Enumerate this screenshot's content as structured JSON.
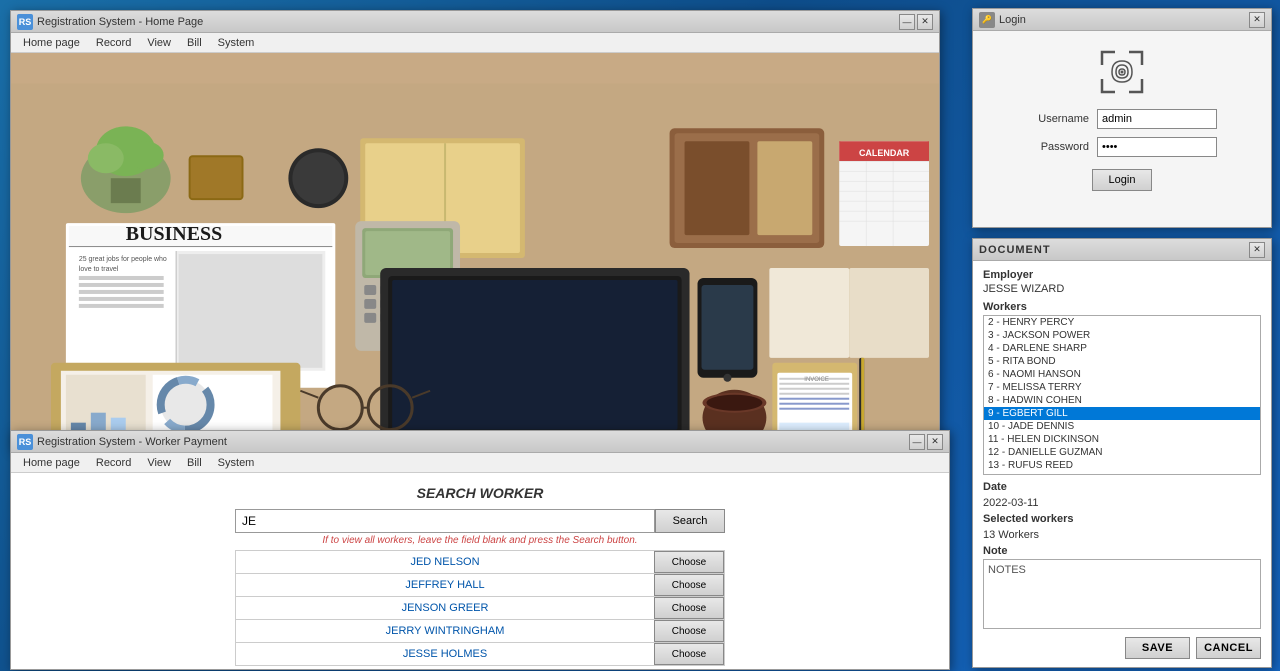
{
  "desktop": {
    "background_color": "#1a6fa8"
  },
  "home_window": {
    "title": "Registration System - Home Page",
    "icon": "RS",
    "controls": {
      "minimize": "—",
      "close": "✕"
    },
    "menu": {
      "items": [
        "Home page",
        "Record",
        "View",
        "Bill",
        "System"
      ]
    }
  },
  "payment_window": {
    "title": "Registration System - Worker Payment",
    "icon": "RS",
    "controls": {
      "minimize": "—",
      "close": "✕"
    },
    "menu": {
      "items": [
        "Home page",
        "Record",
        "View",
        "Bill",
        "System"
      ]
    },
    "content": {
      "title": "SEARCH WORKER",
      "search_value": "JE",
      "search_button": "Search",
      "hint": "If to view all workers, leave the field blank and press the Search button.",
      "workers": [
        {
          "name": "JED NELSON",
          "choose": "Choose"
        },
        {
          "name": "JEFFREY HALL",
          "choose": "Choose"
        },
        {
          "name": "JENSON GREER",
          "choose": "Choose"
        },
        {
          "name": "JERRY WINTRINGHAM",
          "choose": "Choose"
        },
        {
          "name": "JESSE HOLMES",
          "choose": "Choose"
        }
      ]
    }
  },
  "login_window": {
    "title": "Login",
    "username_label": "Username",
    "username_value": "admin",
    "password_label": "Password",
    "password_value": "••••",
    "login_button": "Login"
  },
  "document_window": {
    "title": "DOCUMENT",
    "employer_label": "Employer",
    "employer_value": "JESSE WIZARD",
    "workers_label": "Workers",
    "workers": [
      "2 - HENRY PERCY",
      "3 - JACKSON POWER",
      "4 - DARLENE SHARP",
      "5 - RITA BOND",
      "6 - NAOMI HANSON",
      "7 - MELISSA TERRY",
      "8 - HADWIN COHEN",
      "9 - EGBERT GILL",
      "10 - JADE DENNIS",
      "11 - HELEN DICKINSON",
      "12 - DANIELLE GUZMAN",
      "13 - RUFUS REED"
    ],
    "selected_worker_index": 7,
    "date_label": "Date",
    "date_value": "2022-03-11",
    "selected_workers_label": "Selected workers",
    "selected_workers_value": "13 Workers",
    "note_label": "Note",
    "note_value": "NOTES",
    "save_button": "SAVE",
    "cancel_button": "CANCEL"
  }
}
